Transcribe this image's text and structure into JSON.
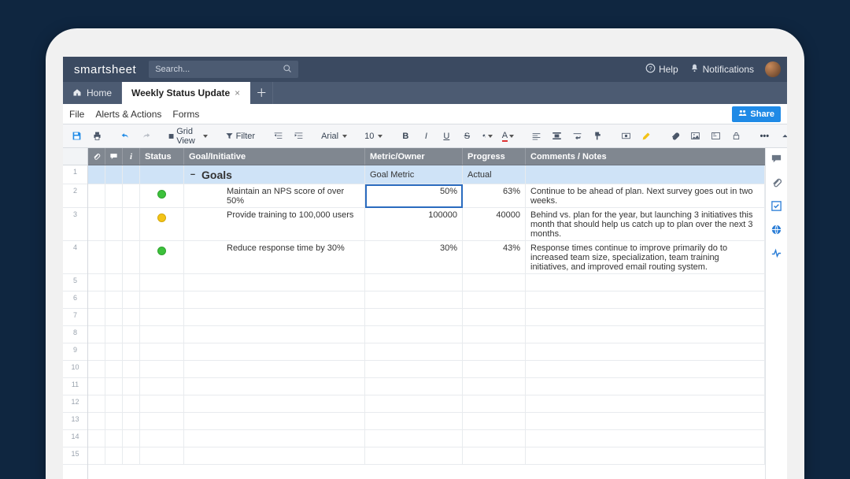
{
  "brand": "smartsheet",
  "search": {
    "placeholder": "Search..."
  },
  "topbar": {
    "help": "Help",
    "notifications": "Notifications"
  },
  "tabs": {
    "home": "Home",
    "active": "Weekly Status Update"
  },
  "menu": {
    "file": "File",
    "alerts": "Alerts & Actions",
    "forms": "Forms",
    "share": "Share"
  },
  "toolbar": {
    "gridview": "Grid View",
    "filter": "Filter",
    "font": "Arial",
    "fontsize": "10"
  },
  "columns": {
    "status": "Status",
    "goal": "Goal/Initiative",
    "metric": "Metric/Owner",
    "progress": "Progress",
    "notes": "Comments / Notes"
  },
  "section": {
    "title": "Goals",
    "metric_header": "Goal Metric",
    "progress_header": "Actual"
  },
  "rows": [
    {
      "status": "green",
      "goal": "Maintain an NPS score of over 50%",
      "metric": "50%",
      "progress": "63%",
      "notes": "Continue to be ahead of plan. Next survey goes out in two weeks."
    },
    {
      "status": "yellow",
      "goal": "Provide training to 100,000 users",
      "metric": "100000",
      "progress": "40000",
      "notes": "Behind vs. plan for the year, but launching 3 initiatives this month that should help us catch up to plan over the next 3 months."
    },
    {
      "status": "green",
      "goal": "Reduce response time by 30%",
      "metric": "30%",
      "progress": "43%",
      "notes": "Response times continue to improve primarily do to increased team size, specialization, team training initiatives, and improved email routing system."
    }
  ],
  "chart_data": {
    "type": "table",
    "title": "Weekly Status Update — Goals",
    "columns": [
      "Status",
      "Goal/Initiative",
      "Metric/Owner",
      "Progress",
      "Comments / Notes"
    ],
    "data": [
      [
        "green",
        "Maintain an NPS score of over 50%",
        "50%",
        "63%",
        "Continue to be ahead of plan. Next survey goes out in two weeks."
      ],
      [
        "yellow",
        "Provide training to 100,000 users",
        "100000",
        "40000",
        "Behind vs. plan for the year, but launching 3 initiatives this month that should help us catch up to plan over the next 3 months."
      ],
      [
        "green",
        "Reduce response time by 30%",
        "30%",
        "43%",
        "Response times continue to improve primarily do to increased team size, specialization, team training initiatives, and improved email routing system."
      ]
    ]
  }
}
